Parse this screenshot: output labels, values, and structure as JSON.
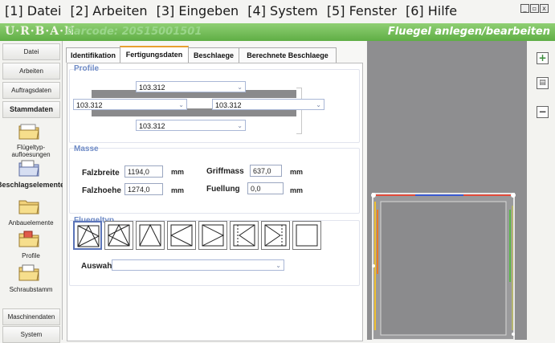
{
  "menu": {
    "items": [
      "[1] Datei",
      "[2] Arbeiten",
      "[3] Eingeben",
      "[4] System",
      "[5] Fenster",
      "[6] Hilfe"
    ],
    "window_controls": [
      "_",
      "▫",
      "x"
    ]
  },
  "titlebar": {
    "logo": "U·R·B·A·N",
    "barcode": "Barcode: 20S15001501",
    "title": "Fluegel anlegen/bearbeiten",
    "color": "#6dbb52"
  },
  "sidebar": {
    "buttons_top": [
      "Datei",
      "Arbeiten",
      "Auftragsdaten",
      "Stammdaten"
    ],
    "icon_items": [
      {
        "label": "Flügeltyp-\naufloesungen",
        "icon": "folder-edit-icon"
      },
      {
        "label": "Beschlagselemente",
        "icon": "folder-fittings-icon"
      },
      {
        "label": "Anbauelemente",
        "icon": "folder-icon"
      },
      {
        "label": "Profile",
        "icon": "folder-profile-icon"
      },
      {
        "label": "Schraubstamm",
        "icon": "folder-screw-icon"
      }
    ],
    "buttons_bottom": [
      "Maschinendaten",
      "System"
    ]
  },
  "tabs": [
    "Identifikation",
    "Fertigungsdaten",
    "Beschlaege",
    "Berechnete Beschlaege"
  ],
  "active_tab": "Fertigungsdaten",
  "profile": {
    "legend": "Profile",
    "top": "103.312",
    "left": "103.312",
    "right": "103.312",
    "bottom": "103.312"
  },
  "masse": {
    "legend": "Masse",
    "falzbreite_label": "Falzbreite",
    "falzbreite_value": "1194,0",
    "falzhoehe_label": "Falzhoehe",
    "falzhoehe_value": "1274,0",
    "griffmass_label": "Griffmass",
    "griffmass_value": "637,0",
    "fuellung_label": "Fuellung",
    "fuellung_value": "0,0",
    "unit": "mm"
  },
  "fluegeltyp": {
    "legend": "Fluegeltyp",
    "selected_index": 0,
    "auswahl_label": "Auswahl",
    "auswahl_value": ""
  },
  "toolbar_right": [
    "add-icon",
    "document-icon",
    "remove-icon"
  ]
}
